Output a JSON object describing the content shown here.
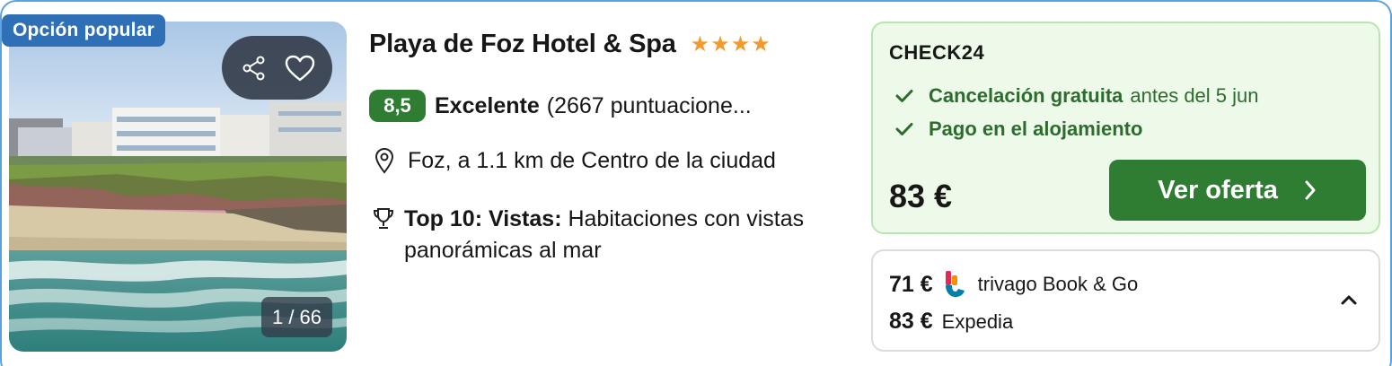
{
  "image": {
    "badge": "Opción popular",
    "counter": "1 / 66",
    "icons": [
      "share-icon",
      "heart-icon"
    ]
  },
  "hotel": {
    "name": "Playa de Foz Hotel & Spa",
    "stars": "★★★★",
    "rating_score": "8,5",
    "rating_label": "Excelente",
    "rating_count": "(2667 puntuacione...",
    "location": "Foz, a 1.1 km de Centro de la ciudad",
    "award_bold": "Top 10: Vistas:",
    "award_text": " Habitaciones con vistas panorámicas al mar"
  },
  "offer": {
    "provider": "CHECK24",
    "perk1_bold": "Cancelación gratuita",
    "perk1_rest": "antes del 5 jun",
    "perk2_bold": "Pago en el alojamiento",
    "price": "83 €",
    "cta_label": "Ver oferta"
  },
  "other_offers": [
    {
      "price": "71 €",
      "provider": "trivago Book & Go"
    },
    {
      "price": "83 €",
      "provider": "Expedia"
    }
  ],
  "colors": {
    "accent_green": "#2e7d32",
    "badge_blue": "#2f6fb5",
    "star_orange": "#f29a2e",
    "offer_bg": "#eefae9"
  }
}
